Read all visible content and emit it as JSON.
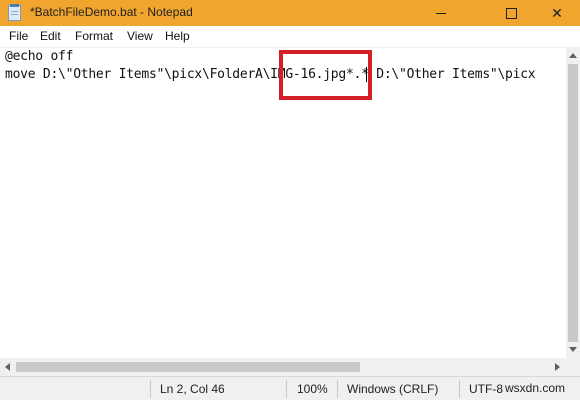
{
  "window": {
    "title": "*BatchFileDemo.bat - Notepad",
    "accent_color": "#f0a52f",
    "controls": {
      "minimize_icon": "minimize-icon",
      "maximize_icon": "maximize-icon",
      "close_icon": "close-icon",
      "close_glyph": "✕"
    }
  },
  "menu": {
    "items": [
      {
        "label": "File"
      },
      {
        "label": "Edit"
      },
      {
        "label": "Format"
      },
      {
        "label": "View"
      },
      {
        "label": "Help"
      }
    ]
  },
  "editor": {
    "lines": [
      "@echo off",
      "move D:\\\"Other Items\"\\picx\\FolderA\\IMG-16.jpg*.* D:\\\"Other Items\"\\picx"
    ],
    "highlight_color": "#d32027"
  },
  "statusbar": {
    "position": "Ln 2, Col 46",
    "zoom": "100%",
    "line_ending": "Windows (CRLF)",
    "encoding": "UTF-8"
  },
  "watermark": "wsxdn.com"
}
